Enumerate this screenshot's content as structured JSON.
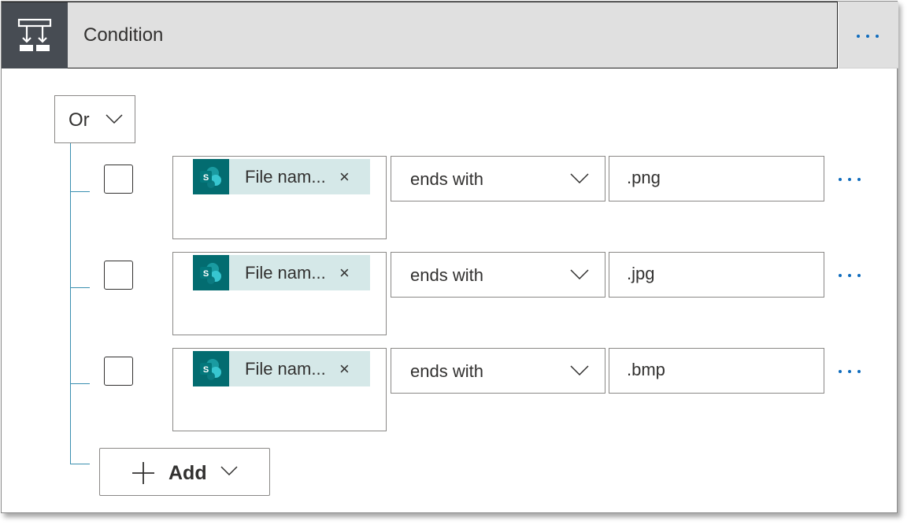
{
  "condition": {
    "title": "Condition",
    "icon": "condition-icon"
  },
  "group": {
    "operator": "Or"
  },
  "rows": [
    {
      "token_label": "File nam...",
      "operator": "ends with",
      "value": ".png"
    },
    {
      "token_label": "File nam...",
      "operator": "ends with",
      "value": ".jpg"
    },
    {
      "token_label": "File nam...",
      "operator": "ends with",
      "value": ".bmp"
    }
  ],
  "token_remove": "×",
  "add_button": {
    "label": "Add"
  },
  "colors": {
    "header_bg": "#e0e0e0",
    "icon_bg": "#474c53",
    "sharepoint": "#036c70",
    "token_bg": "#d5e8e8",
    "accent": "#0f6cbd",
    "tree_line": "#3a8fb0"
  }
}
